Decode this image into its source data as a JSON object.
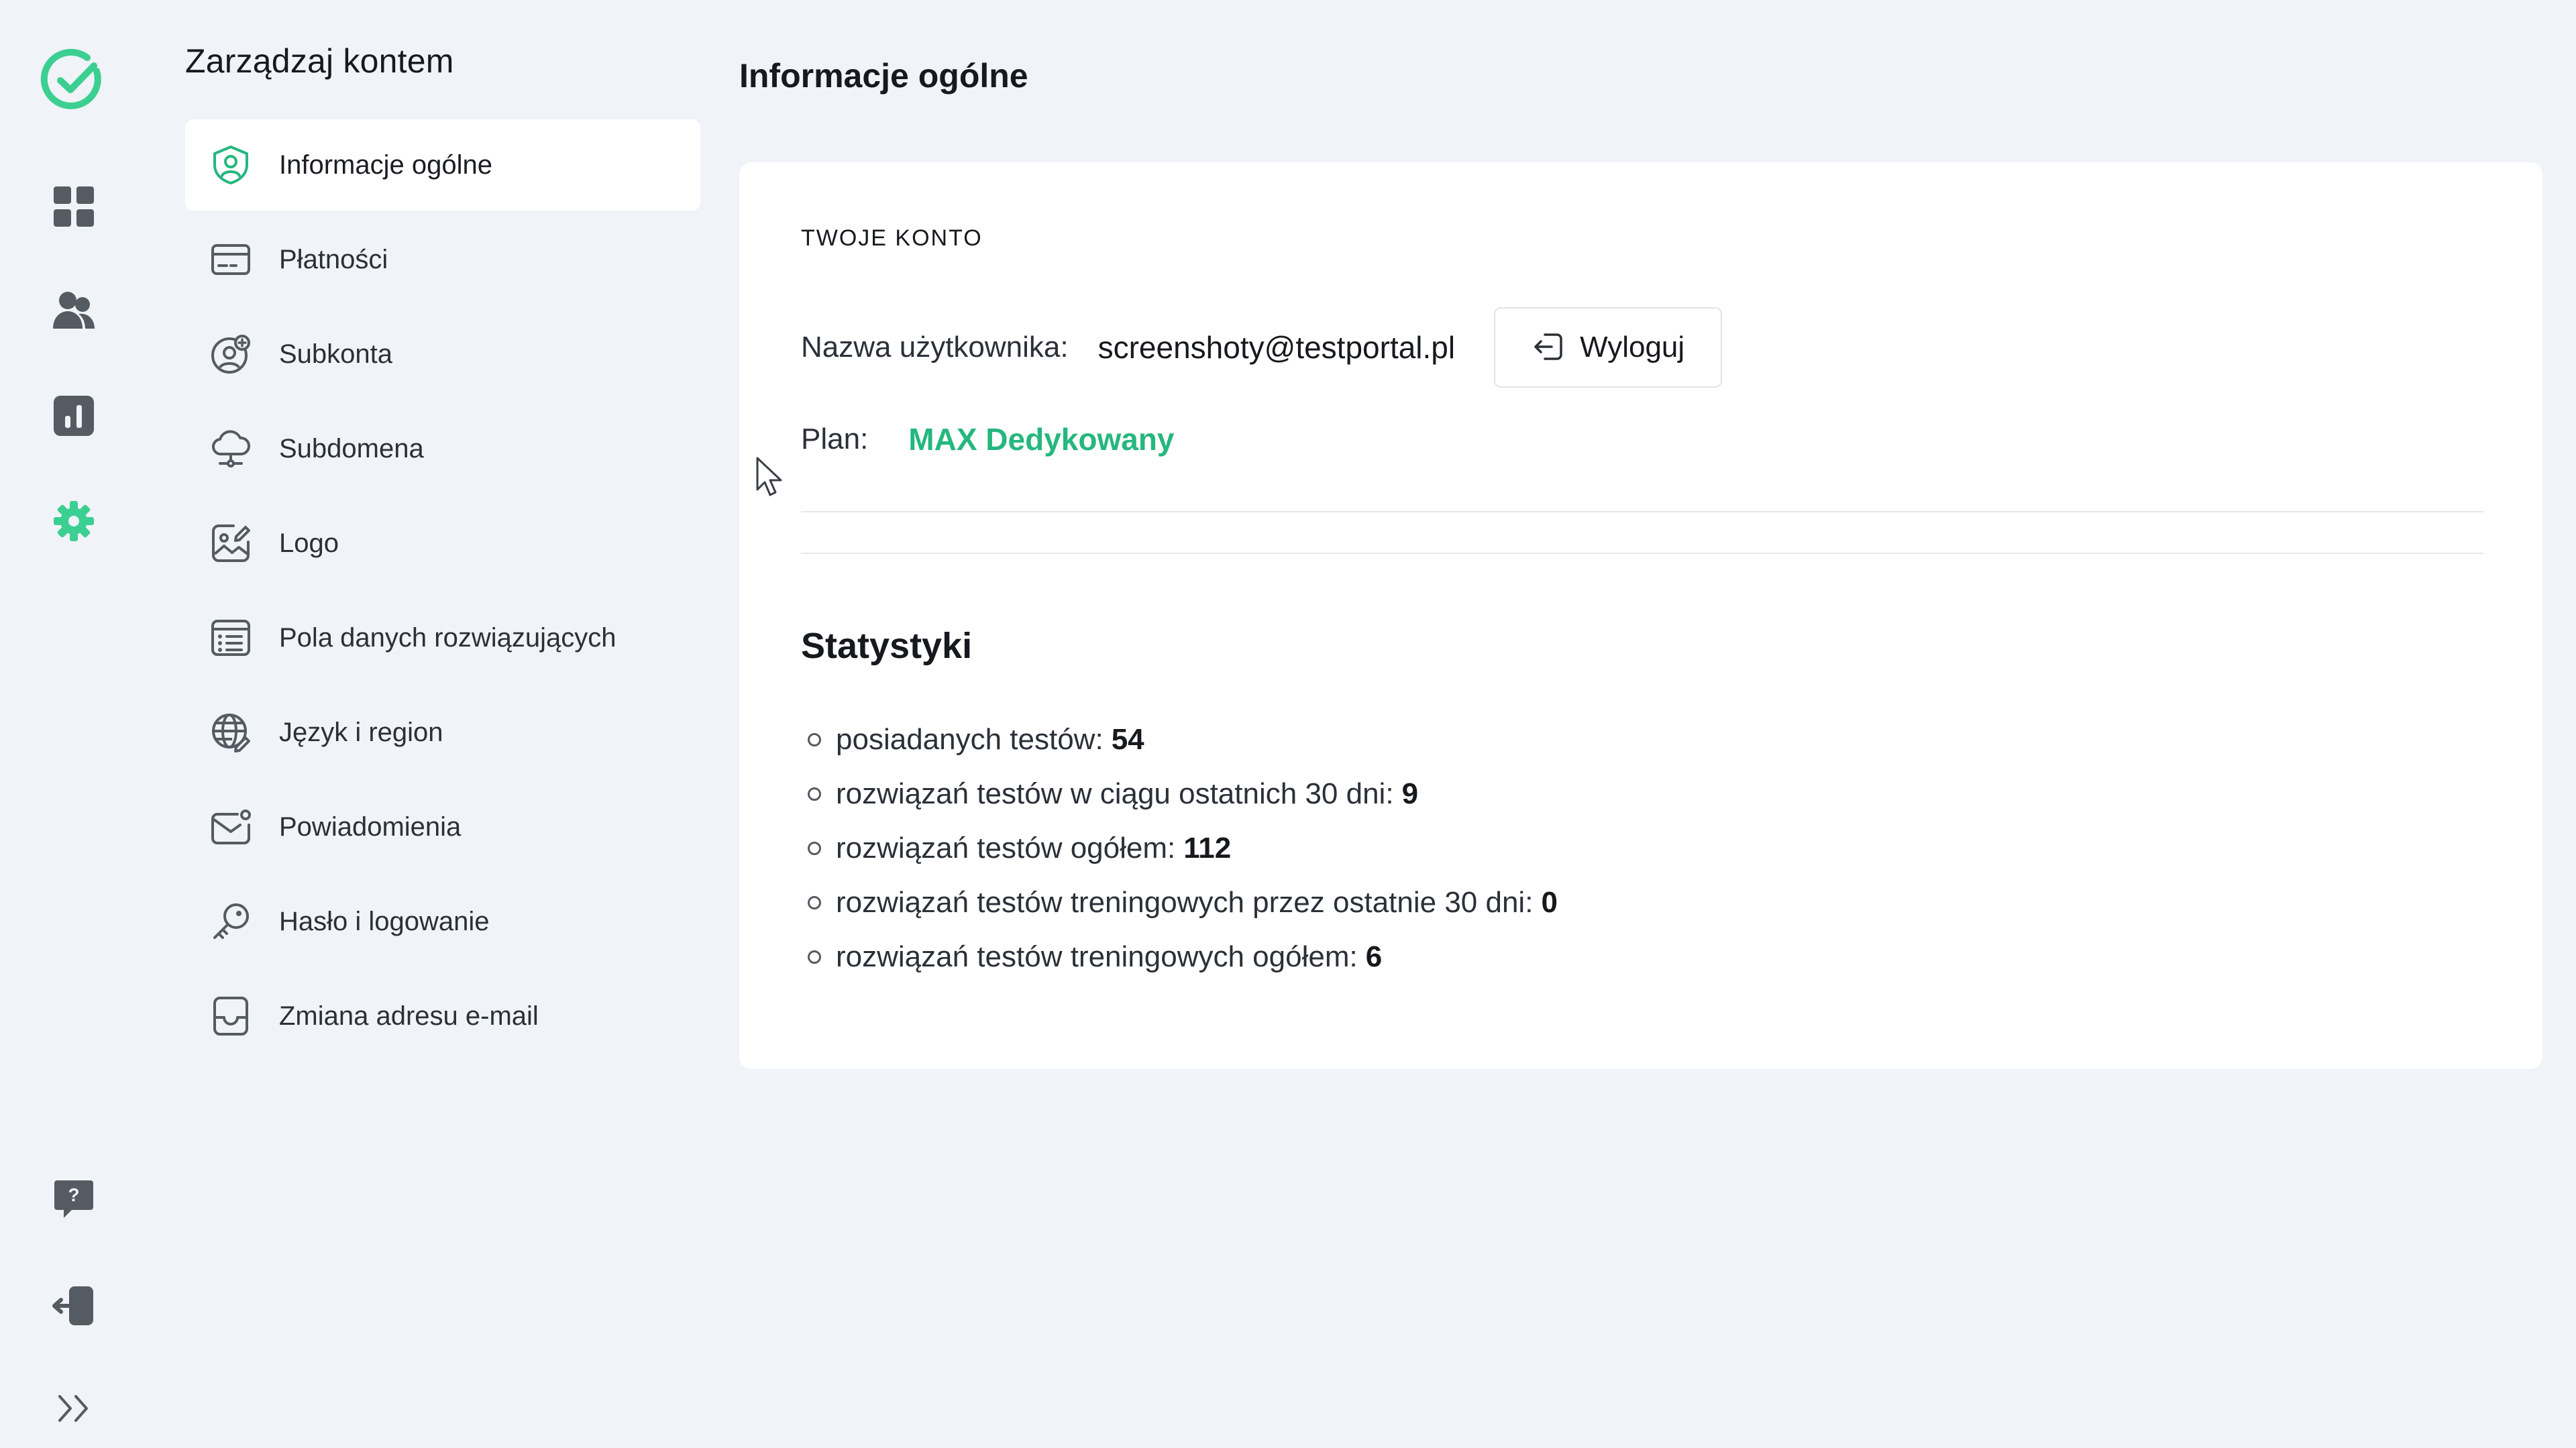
{
  "rail": {
    "logo_icon": "check-circle-logo-icon",
    "nav_icons": [
      "dashboard-grid-icon",
      "users-icon",
      "chart-icon",
      "gear-icon"
    ],
    "bottom_icons": [
      "help-chat-icon",
      "logout-door-icon",
      "expand-chevrons-icon"
    ]
  },
  "menu": {
    "title": "Zarządzaj kontem",
    "items": [
      {
        "label": "Informacje ogólne",
        "icon": "user-badge-icon",
        "active": true
      },
      {
        "label": "Płatności",
        "icon": "credit-card-icon",
        "active": false
      },
      {
        "label": "Subkonta",
        "icon": "subaccount-icon",
        "active": false
      },
      {
        "label": "Subdomena",
        "icon": "cloud-network-icon",
        "active": false
      },
      {
        "label": "Logo",
        "icon": "image-edit-icon",
        "active": false
      },
      {
        "label": "Pola danych rozwiązujących",
        "icon": "data-fields-icon",
        "active": false
      },
      {
        "label": "Język i region",
        "icon": "globe-edit-icon",
        "active": false
      },
      {
        "label": "Powiadomienia",
        "icon": "mail-notification-icon",
        "active": false
      },
      {
        "label": "Hasło i logowanie",
        "icon": "key-icon",
        "active": false
      },
      {
        "label": "Zmiana adresu e-mail",
        "icon": "inbox-icon",
        "active": false
      }
    ]
  },
  "main": {
    "title": "Informacje ogólne",
    "account": {
      "section_label": "TWOJE KONTO",
      "username_label": "Nazwa użytkownika:",
      "username_value": "screenshoty@testportal.pl",
      "logout_label": "Wyloguj",
      "plan_label": "Plan:",
      "plan_value": "MAX Dedykowany"
    },
    "stats": {
      "title": "Statystyki",
      "items": [
        {
          "label": "posiadanych testów:",
          "value": "54"
        },
        {
          "label": "rozwiązań testów w ciągu ostatnich 30 dni:",
          "value": "9"
        },
        {
          "label": "rozwiązań testów ogółem:",
          "value": "112"
        },
        {
          "label": "rozwiązań testów treningowych przez ostatnie 30 dni:",
          "value": "0"
        },
        {
          "label": "rozwiązań testów treningowych ogółem:",
          "value": "6"
        }
      ]
    }
  },
  "colors": {
    "accent": "#25b77f",
    "background": "#f0f3f7",
    "card": "#ffffff",
    "icon_gray": "#555b63"
  }
}
